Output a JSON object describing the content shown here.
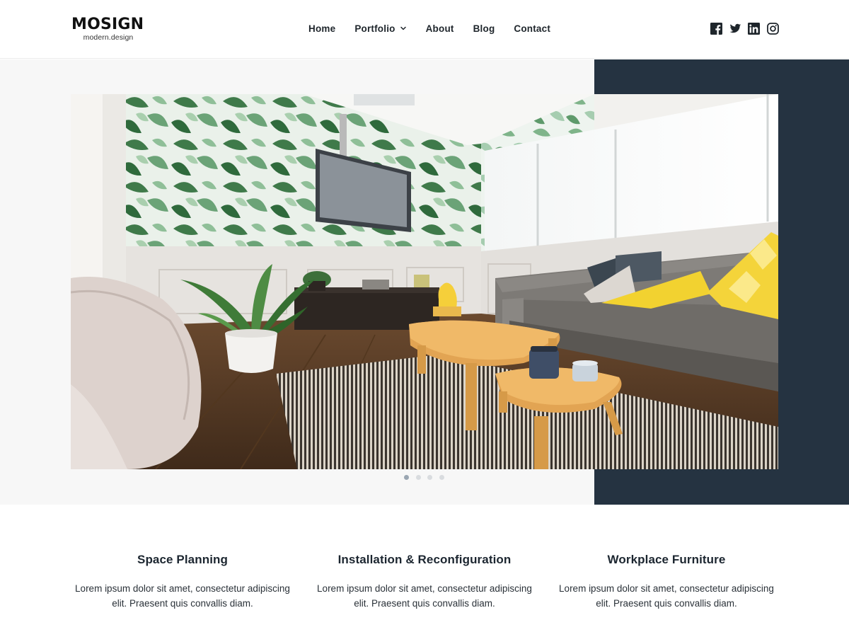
{
  "brand": {
    "name": "MOSIGN",
    "tagline": "modern.design"
  },
  "nav": {
    "items": [
      {
        "label": "Home"
      },
      {
        "label": "Portfolio",
        "has_dropdown": true
      },
      {
        "label": "About"
      },
      {
        "label": "Blog"
      },
      {
        "label": "Contact"
      }
    ]
  },
  "social": [
    "facebook-icon",
    "twitter-icon",
    "linkedin-icon",
    "instagram-icon"
  ],
  "hero": {
    "slide_count": 4,
    "active_slide": 1,
    "image": "living room interior with banana-leaf wallpaper, wall-mounted TV, grey sofa with yellow cushions, wooden nesting coffee tables, striped rug, bean bag"
  },
  "services": [
    {
      "title": "Space Planning",
      "text": "Lorem ipsum dolor sit amet, consectetur adipiscing elit. Praesent quis convallis diam."
    },
    {
      "title": "Installation & Reconfiguration",
      "text": "Lorem ipsum dolor sit amet, consectetur adipiscing elit. Praesent quis convallis diam."
    },
    {
      "title": "Workplace Furniture",
      "text": "Lorem ipsum dolor sit amet, consectetur adipiscing elit. Praesent quis convallis diam."
    }
  ],
  "colors": {
    "dark_panel": "#253341",
    "light_panel": "#f7f7f7",
    "accent_yellow": "#f2d230"
  }
}
